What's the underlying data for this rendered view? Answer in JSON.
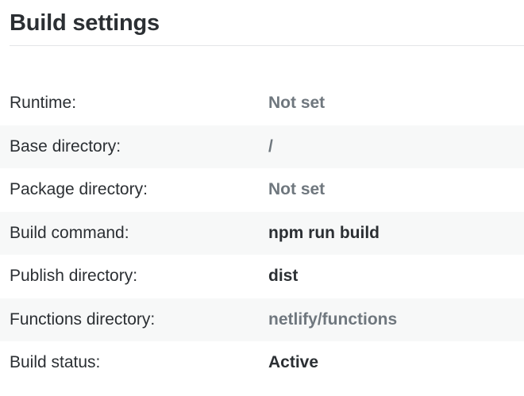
{
  "page": {
    "title": "Build settings"
  },
  "settings": [
    {
      "label": "Runtime:",
      "value": "Not set",
      "style": "muted"
    },
    {
      "label": "Base directory:",
      "value": "/",
      "style": "muted"
    },
    {
      "label": "Package directory:",
      "value": "Not set",
      "style": "muted"
    },
    {
      "label": "Build command:",
      "value": "npm run build",
      "style": "strong"
    },
    {
      "label": "Publish directory:",
      "value": "dist",
      "style": "strong"
    },
    {
      "label": "Functions directory:",
      "value": "netlify/functions",
      "style": "muted"
    },
    {
      "label": "Build status:",
      "value": "Active",
      "style": "strong"
    }
  ],
  "colors": {
    "text": "#2b2f33",
    "muted_value": "#6f777e",
    "stripe": "#f7f8f8",
    "divider": "#e3e5e8"
  }
}
